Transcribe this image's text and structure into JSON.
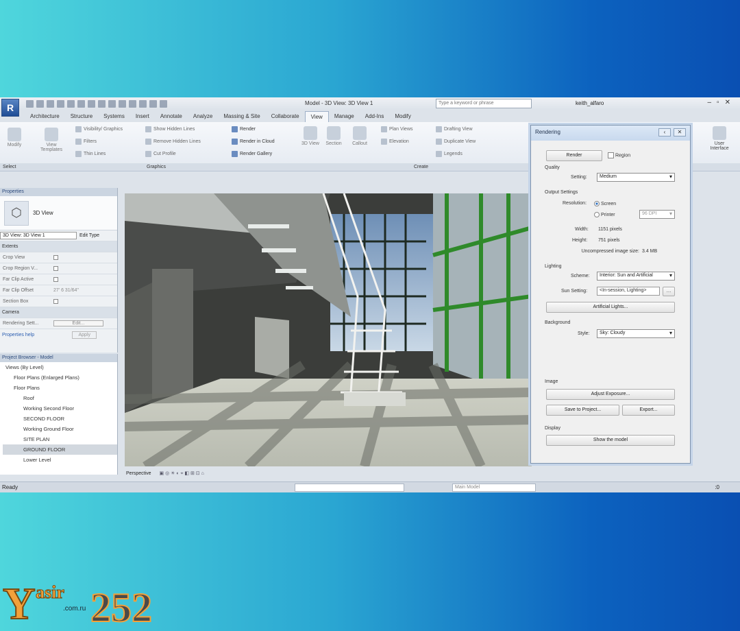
{
  "app": {
    "title": "Model - 3D View: 3D View 1",
    "search_placeholder": "Type a keyword or phrase",
    "user": "keith_alfaro",
    "logo_letter": "R"
  },
  "tabs": [
    "Architecture",
    "Structure",
    "Systems",
    "Insert",
    "Annotate",
    "Analyze",
    "Massing & Site",
    "Collaborate",
    "View",
    "Manage",
    "Add-Ins",
    "Modify"
  ],
  "active_tab": "View",
  "ribbon": {
    "modify": "Modify",
    "view_templates": "View Templates",
    "visibility": "Visibility/ Graphics",
    "filters": "Filters",
    "thin_lines": "Thin Lines",
    "show_hidden": "Show Hidden Lines",
    "remove_hidden": "Remove Hidden Lines",
    "cut_profile": "Cut Profile",
    "render": "Render",
    "render_cloud": "Render in Cloud",
    "render_gallery": "Render Gallery",
    "view_3d": "3D View",
    "section": "Section",
    "callout": "Callout",
    "plan_views": "Plan Views",
    "elevation": "Elevation",
    "drafting_view": "Drafting View",
    "duplicate_view": "Duplicate View",
    "legends": "Legends",
    "user_interface": "User Interface",
    "select": "Select",
    "graphics": "Graphics",
    "create": "Create"
  },
  "properties": {
    "header": "Properties",
    "type": "3D View",
    "instance": "3D View: 3D View 1",
    "edit_type": "Edit Type",
    "section_extents": "Extents",
    "rows": [
      {
        "k": "Crop View",
        "v": ""
      },
      {
        "k": "Crop Region V...",
        "v": ""
      },
      {
        "k": "Far Clip Active",
        "v": ""
      },
      {
        "k": "Far Clip Offset",
        "v": "27' 6 31/64\""
      },
      {
        "k": "Section Box",
        "v": ""
      }
    ],
    "section_camera": "Camera",
    "rendering_settings": "Rendering Sett...",
    "edit_button": "Edit...",
    "help": "Properties help",
    "apply": "Apply"
  },
  "browser": {
    "header": "Project Browser - Model",
    "items": [
      {
        "label": "Views (By Level)",
        "level": 1
      },
      {
        "label": "Floor Plans (Enlarged Plans)",
        "level": 2
      },
      {
        "label": "Floor Plans",
        "level": 2
      },
      {
        "label": "Roof",
        "level": 3
      },
      {
        "label": "Working Second Floor",
        "level": 3
      },
      {
        "label": "SECOND FLOOR",
        "level": 3
      },
      {
        "label": "Working Ground Floor",
        "level": 3
      },
      {
        "label": "SITE PLAN",
        "level": 3
      },
      {
        "label": "GROUND FLOOR",
        "level": 3,
        "selected": true
      },
      {
        "label": "Lower Level",
        "level": 3
      }
    ]
  },
  "view_bar": {
    "label": "Perspective"
  },
  "status": {
    "ready": "Ready",
    "main_model": "Main Model",
    "zero": ":0"
  },
  "dialog": {
    "title": "Rendering",
    "render_button": "Render",
    "region": "Region",
    "quality_label": "Quality",
    "setting_label": "Setting:",
    "setting_value": "Medium",
    "output_label": "Output Settings",
    "resolution_label": "Resolution:",
    "screen": "Screen",
    "printer": "Printer",
    "dpi": "96 DPI",
    "width_label": "Width:",
    "width_value": "1151 pixels",
    "height_label": "Height:",
    "height_value": "751 pixels",
    "size_label": "Uncompressed image size:",
    "size_value": "3.4 MB",
    "lighting_label": "Lighting",
    "scheme_label": "Scheme:",
    "scheme_value": "Interior: Sun and Artificial",
    "sun_label": "Sun Setting:",
    "sun_value": "<In-session, Lighting>",
    "artificial_button": "Artificial Lights...",
    "background_label": "Background",
    "style_label": "Style:",
    "style_value": "Sky: Cloudy",
    "image_label": "Image",
    "adjust_button": "Adjust Exposure...",
    "save_button": "Save to Project...",
    "export_button": "Export...",
    "display_label": "Display",
    "show_model_button": "Show the model"
  },
  "watermark": {
    "brand": "asir",
    "letter": "Y",
    "number": "252",
    "domain": ".com.ru"
  }
}
